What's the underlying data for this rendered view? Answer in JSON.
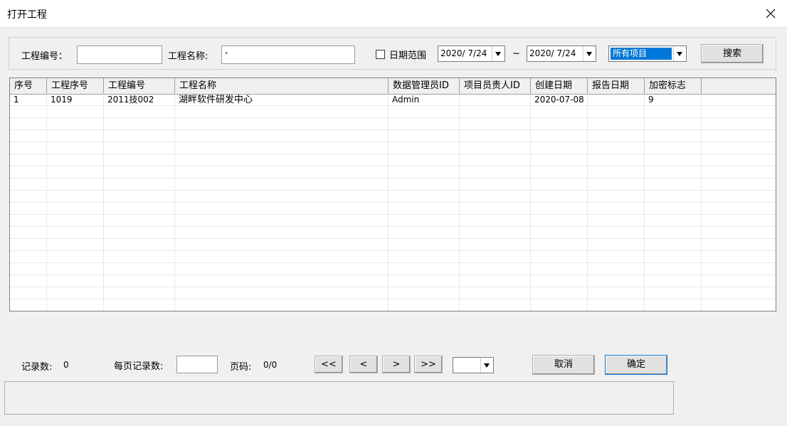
{
  "window": {
    "title": "打开工程"
  },
  "search": {
    "project_no_label": "工程编号：",
    "project_no_value": "",
    "project_name_label": "工程名称:",
    "project_name_value": "-",
    "date_range_label": "日期范围",
    "date_range_checked": false,
    "date_from": "2020/  7/24",
    "tilde": "~",
    "date_to": "2020/  7/24",
    "filter_selected": "所有项目",
    "search_button": "搜索"
  },
  "table": {
    "columns": [
      "序号",
      "工程序号",
      "工程编号",
      "工程名称",
      "数据管理员ID",
      "项目员责人ID",
      "创建日期",
      "报告日期",
      "加密标志"
    ],
    "rows": [
      [
        "1",
        "1019",
        "2011技002",
        "湖畔软件研发中心",
        "Admin",
        "",
        "2020-07-08",
        "",
        "9"
      ]
    ]
  },
  "footer": {
    "record_count_label": "记录数:",
    "record_count_value": "0",
    "per_page_label": "每页记录数:",
    "per_page_value": "",
    "page_label": "页码:",
    "page_value": "0/0",
    "first_button": "<<",
    "prev_button": "<",
    "next_button": ">",
    "last_button": ">>",
    "page_select_value": "",
    "cancel_button": "取消",
    "ok_button": "确定"
  },
  "icons": {
    "close": "close-icon",
    "dropdown": "chevron-down-icon"
  },
  "colors": {
    "selection": "#0078d7",
    "background": "#f0f0f0"
  }
}
